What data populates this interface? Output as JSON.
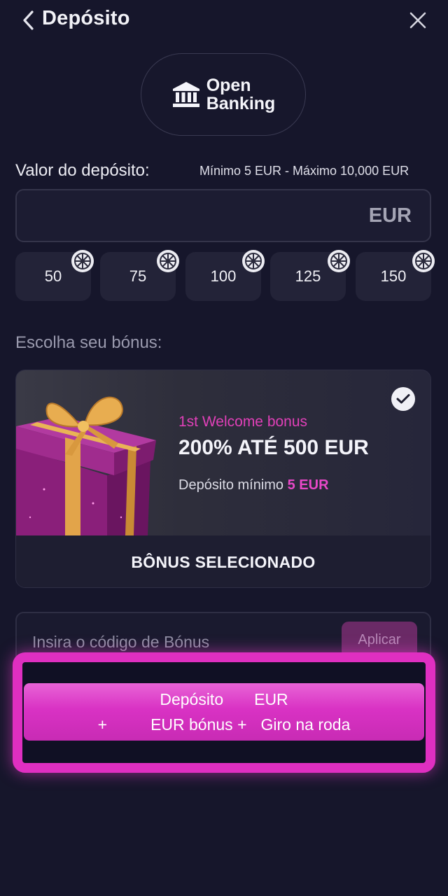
{
  "header": {
    "title": "Depósito",
    "back_icon": "chevron-left-icon",
    "close_icon": "close-icon"
  },
  "payment_method": {
    "icon": "bank-icon",
    "label_line1": "Open",
    "label_line2": "Banking"
  },
  "amount": {
    "label": "Valor do depósito:",
    "limits": "Mínimo 5 EUR - Máximo 10,000 EUR",
    "value": "",
    "currency": "EUR"
  },
  "quick_amounts": [
    "50",
    "75",
    "100",
    "125",
    "150"
  ],
  "bonus": {
    "heading": "Escolha seu bónus:",
    "subtitle": "1st Welcome bonus",
    "title": "200% ATÉ 500 EUR",
    "min_deposit_label": "Depósito mínimo",
    "min_deposit_value": "5 EUR",
    "footer": "BÔNUS SELECIONADO",
    "selected": true
  },
  "promo": {
    "placeholder": "Insira o código de Bónus",
    "apply_label": "Aplicar"
  },
  "deposit_button": {
    "line1_prefix": "Depósito",
    "line1_suffix": "EUR",
    "line2_plus1": "+",
    "line2_bonus": "EUR bónus +",
    "line2_spin": "Giro na roda"
  },
  "colors": {
    "background": "#16162b",
    "accent": "#df2fc1",
    "bonus_pink": "#e040b8"
  }
}
